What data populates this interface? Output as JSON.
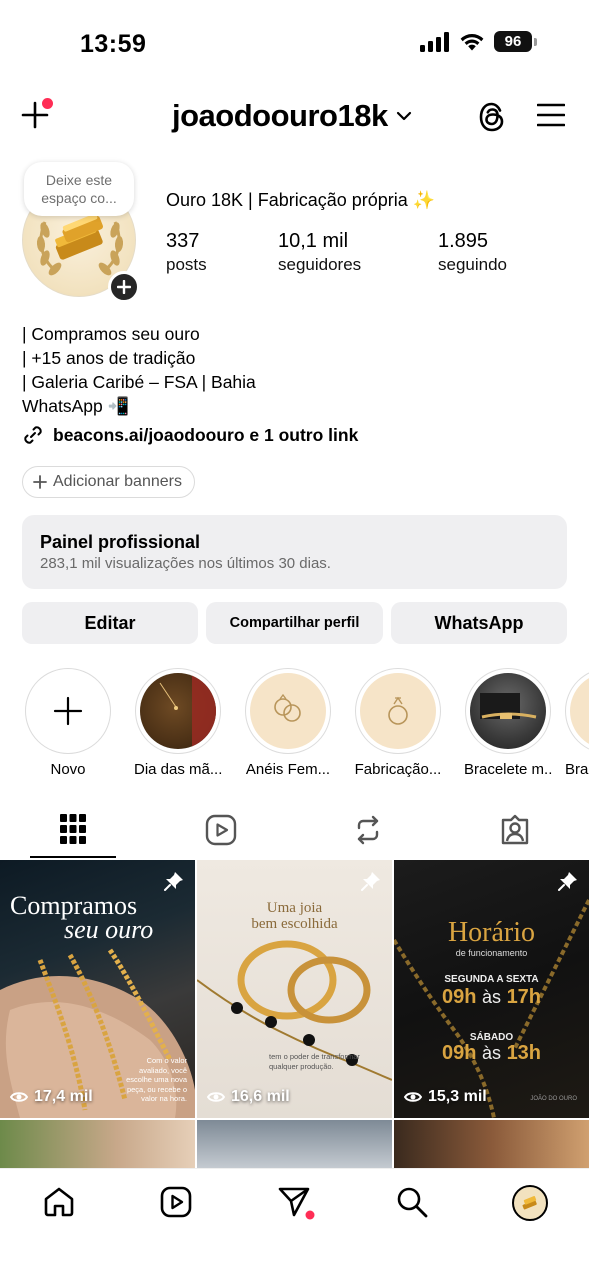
{
  "status_bar": {
    "time": "13:59",
    "battery": "96"
  },
  "header": {
    "username": "joaodoouro18k"
  },
  "profile": {
    "note": "Deixe este espaço co...",
    "display_name": "Ouro 18K | Fabricação própria ✨",
    "stats": {
      "posts": {
        "value": "337",
        "label": "posts"
      },
      "followers": {
        "value": "10,1 mil",
        "label": "seguidores"
      },
      "following": {
        "value": "1.895",
        "label": "seguindo"
      }
    },
    "bio_lines": [
      "| Compramos seu ouro",
      "| +15 anos de tradição",
      "| Galeria Caribé – FSA | Bahia",
      "WhatsApp 📲"
    ],
    "link_text": "beacons.ai/joaodoouro e 1 outro link",
    "add_banners": "Adicionar banners"
  },
  "panel": {
    "title": "Painel profissional",
    "subtitle": "283,1 mil visualizações nos últimos 30 dias."
  },
  "actions": {
    "edit": "Editar",
    "share": "Compartilhar perfil",
    "whatsapp": "WhatsApp"
  },
  "highlights": [
    {
      "label": "Novo"
    },
    {
      "label": "Dia das mã..."
    },
    {
      "label": "Anéis Fem..."
    },
    {
      "label": "Fabricação..."
    },
    {
      "label": "Bracelete m..."
    },
    {
      "label": "Bra"
    }
  ],
  "posts": [
    {
      "views": "17,4 mil",
      "headline": "Compramos",
      "headline2": "seu ouro",
      "caption": "Com o valor avaliado, você escolhe uma nova peça, ou recebe o valor na hora."
    },
    {
      "views": "16,6 mil",
      "headline": "Uma joia",
      "headline2": "bem escolhida",
      "caption": "tem o poder de transformar qualquer produção."
    },
    {
      "views": "15,3 mil",
      "headline": "Horário",
      "headline2": "de funcionamento",
      "line1": "SEGUNDA A SEXTA",
      "time1a": "09h",
      "time1sep": "às",
      "time1b": "17h",
      "line2": "SÁBADO",
      "time2a": "09h",
      "time2sep": "às",
      "time2b": "13h",
      "brand": "JOÃO DO OURO"
    }
  ],
  "colors": {
    "accent_red": "#ff2d55",
    "gold": "#d9a441",
    "panel_bg": "#efeff1"
  }
}
